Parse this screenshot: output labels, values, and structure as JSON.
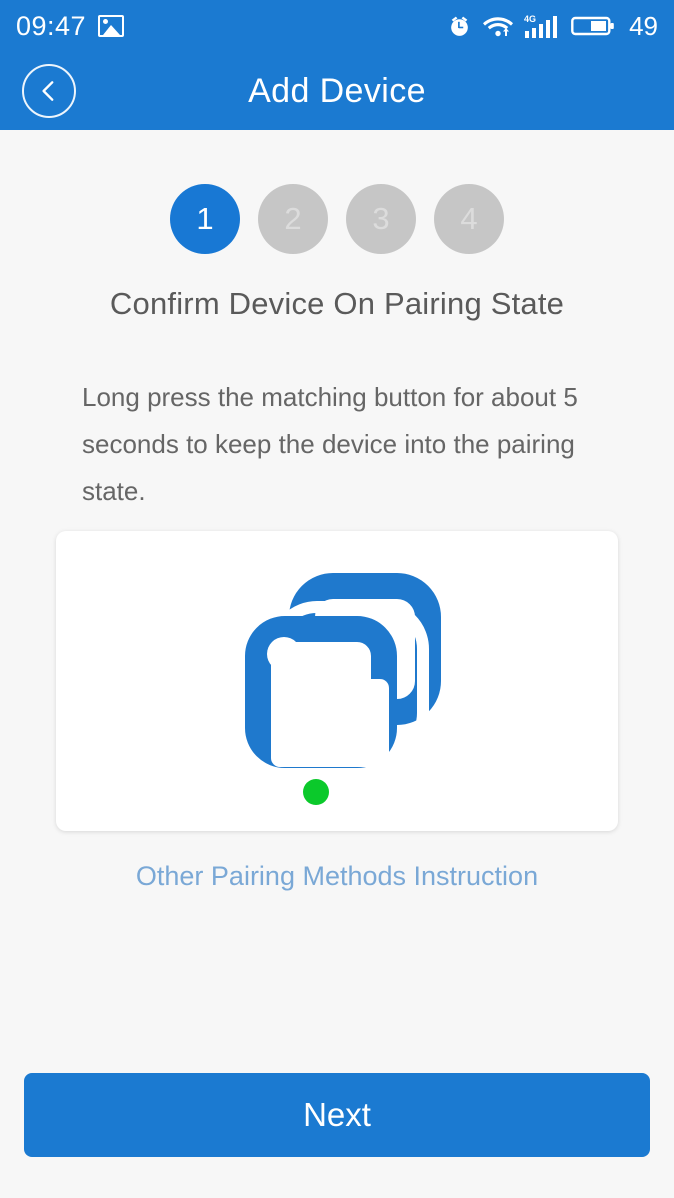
{
  "status_bar": {
    "time": "09:47",
    "photo_icon": "photo-icon",
    "alarm_icon": "alarm-clock-icon",
    "wifi_icon": "wifi-icon",
    "network_label": "4G",
    "signal_icon": "signal-bars-icon",
    "battery_icon": "battery-icon",
    "battery_level": "49"
  },
  "header": {
    "back_icon": "chevron-left-icon",
    "title": "Add Device"
  },
  "steps": {
    "items": [
      {
        "label": "1",
        "state": "active"
      },
      {
        "label": "2",
        "state": "inactive"
      },
      {
        "label": "3",
        "state": "inactive"
      },
      {
        "label": "4",
        "state": "inactive"
      }
    ],
    "active_color": "#1878d4",
    "inactive_color": "#c6c6c6"
  },
  "main": {
    "title": "Confirm Device On Pairing State",
    "description": "Long press the matching button for about 5 seconds to keep the device into the pairing state.",
    "device_illustration": {
      "icon": "device-pairing-icon",
      "device_color": "#1f79cd",
      "status_dot_color": "#0bc92b",
      "status_dot": "pairing-status-dot"
    },
    "link_label": "Other Pairing Methods Instruction",
    "link_color": "#7aa8d6"
  },
  "footer": {
    "next_label": "Next",
    "next_color": "#1b7ad1"
  }
}
